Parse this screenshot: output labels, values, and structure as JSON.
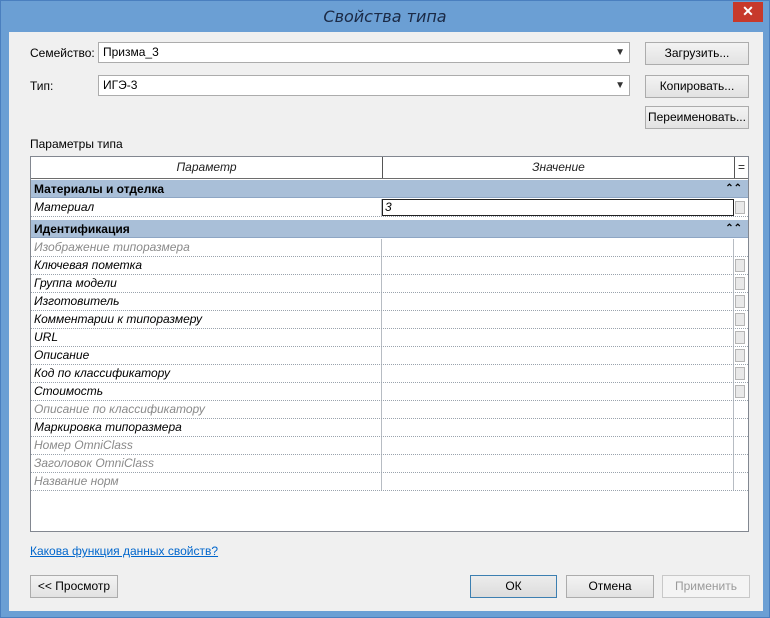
{
  "window": {
    "title": "Свойства типа",
    "close_glyph": "✕"
  },
  "family": {
    "label": "Семейство:",
    "value": "Призма_3",
    "load_button": "Загрузить..."
  },
  "type": {
    "label": "Тип:",
    "value": "ИГЭ-3",
    "copy_button": "Копировать...",
    "rename_button": "Переименовать..."
  },
  "params": {
    "section_label": "Параметры типа",
    "col_param": "Параметр",
    "col_value": "Значение",
    "col_eq": "=",
    "groups": [
      {
        "name": "Материалы и отделка",
        "collapse": "⌃⌃",
        "rows": [
          {
            "param": "Материал",
            "value": "3",
            "gray": false
          }
        ]
      },
      {
        "name": "Идентификация",
        "collapse": "⌃⌃",
        "rows": [
          {
            "param": "Изображение типоразмера",
            "value": "",
            "gray": true
          },
          {
            "param": "Ключевая пометка",
            "value": "",
            "gray": false
          },
          {
            "param": "Группа модели",
            "value": "",
            "gray": false
          },
          {
            "param": "Изготовитель",
            "value": "",
            "gray": false
          },
          {
            "param": "Комментарии к типоразмеру",
            "value": "",
            "gray": false
          },
          {
            "param": "URL",
            "value": "",
            "gray": false
          },
          {
            "param": "Описание",
            "value": "",
            "gray": false
          },
          {
            "param": "Код по классификатору",
            "value": "",
            "gray": false
          },
          {
            "param": "Стоимость",
            "value": "",
            "gray": false
          },
          {
            "param": "Описание по классификатору",
            "value": "",
            "gray": true
          },
          {
            "param": "Маркировка типоразмера",
            "value": "",
            "gray": false
          },
          {
            "param": "Номер OmniClass",
            "value": "",
            "gray": true
          },
          {
            "param": "Заголовок OmniClass",
            "value": "",
            "gray": true
          },
          {
            "param": "Название норм",
            "value": "",
            "gray": true
          }
        ]
      }
    ]
  },
  "help_link": "Какова функция данных свойств?",
  "footer": {
    "preview_button": "<< Просмотр",
    "ok_button": "ОК",
    "cancel_button": "Отмена",
    "apply_button": "Применить"
  }
}
